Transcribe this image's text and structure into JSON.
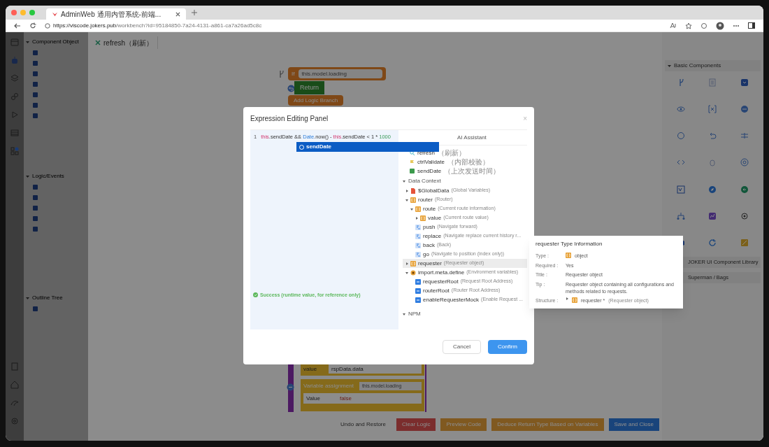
{
  "browser": {
    "tab_title": "AdminWeb 通用内管系统-前端...",
    "url_host": "https://viscode.jokers.pub",
    "url_path": "/workbench?id=95184850-7a24-4131-a861-ca7a26ad5c8c"
  },
  "left_panel": {
    "sections": [
      {
        "title": "Component Object"
      },
      {
        "title": "Logic/Events"
      },
      {
        "title": "Outline Tree"
      }
    ]
  },
  "canvas": {
    "tab": "refresh（刷新）",
    "if_block": {
      "label": "If",
      "field": "this.model.loading"
    },
    "return_block": {
      "label": "Return"
    },
    "branch_block": {
      "label": "Add Logic Branch"
    },
    "value_row": {
      "label": "value",
      "value": "rspData.data"
    },
    "assign_block": {
      "label": "Variable assignment",
      "field": "this.model.loading",
      "row_label": "Value",
      "row_value": "false"
    }
  },
  "bottom_buttons": [
    {
      "label": "Undo and Restore",
      "kind": "plain"
    },
    {
      "label": "Clear Logic",
      "kind": "danger"
    },
    {
      "label": "Preview Code",
      "kind": "warning"
    },
    {
      "label": "Deduce Return Type Based on Variables",
      "kind": "warning"
    },
    {
      "label": "Save and Close",
      "kind": "primary"
    }
  ],
  "right_panel": {
    "section": "Basic Components",
    "libraries": [
      "JOKER UI Component Library",
      "Superman / Bags"
    ]
  },
  "modal": {
    "title": "Expression Editing Panel",
    "close": "×",
    "line_number": "1",
    "code_tokens": [
      {
        "text": "this",
        "kind": "keyword"
      },
      {
        "text": ".sendDate && ",
        "kind": "plain"
      },
      {
        "text": "Date",
        "kind": "class"
      },
      {
        "text": ".now() - ",
        "kind": "plain"
      },
      {
        "text": "this",
        "kind": "keyword"
      },
      {
        "text": ".sendDate < 1 * ",
        "kind": "plain"
      },
      {
        "text": "1000",
        "kind": "number"
      }
    ],
    "suggestion": {
      "label": "sendDate",
      "selected": true
    },
    "tabs": [
      {
        "label": "AI Assistant",
        "selected": false
      }
    ],
    "members": [
      {
        "name": "refresh",
        "desc": "（刷新）",
        "kind": "function"
      },
      {
        "name": "ctrlValidate",
        "desc": "（内部校验）",
        "kind": "handler"
      },
      {
        "name": "sendDate",
        "desc": "（上次发送时间）",
        "kind": "number"
      }
    ],
    "data_context": {
      "title": "Data Context",
      "expanded": true,
      "items": [
        {
          "name": "$GlobalData",
          "desc": "(Global Variables)",
          "kind": "global",
          "expanded": false,
          "selected": false
        },
        {
          "name": "router",
          "desc": "(Router)",
          "kind": "object",
          "expanded": true,
          "selected": false,
          "children": [
            {
              "name": "route",
              "desc": "(Current route information)",
              "kind": "object",
              "expanded": true,
              "selected": false,
              "children": [
                {
                  "name": "value",
                  "desc": "(Current route value)",
                  "kind": "object",
                  "expanded": false,
                  "selected": false
                }
              ]
            },
            {
              "name": "push",
              "desc": "(Navigate forward)",
              "kind": "method",
              "selected": false
            },
            {
              "name": "replace",
              "desc": "(Navigate replace current history r...",
              "kind": "method",
              "selected": false
            },
            {
              "name": "back",
              "desc": "(Back)",
              "kind": "method",
              "selected": false
            },
            {
              "name": "go",
              "desc": "(Navigate to position (index only))",
              "kind": "method",
              "selected": false
            }
          ]
        },
        {
          "name": "requester",
          "desc": "(Requester object)",
          "kind": "object",
          "expanded": false,
          "selected": true
        },
        {
          "name": "import.meta.define",
          "desc": "(Environment variables)",
          "kind": "env",
          "expanded": true,
          "selected": false,
          "children": [
            {
              "name": "requesterRoot",
              "desc": "(Request Root Address)",
              "kind": "string",
              "selected": false
            },
            {
              "name": "routerRoot",
              "desc": "(Router Root Address)",
              "kind": "string",
              "selected": false
            },
            {
              "name": "enableRequesterMock",
              "desc": "(Enable Request ...",
              "kind": "string",
              "selected": false
            }
          ]
        }
      ]
    },
    "npm": {
      "title": "NPM",
      "expanded": true
    },
    "status": "Success (runtime value, for reference only)",
    "buttons": [
      {
        "label": "Cancel",
        "kind": "plain"
      },
      {
        "label": "Confirm",
        "kind": "primary"
      }
    ]
  },
  "tooltip": {
    "title": "requester Type Information",
    "rows": [
      {
        "label": "Type :",
        "value": "object",
        "kind": "type"
      },
      {
        "label": "Required :",
        "value": "Yes",
        "kind": "text"
      },
      {
        "label": "Title :",
        "value": "Requester object",
        "kind": "text"
      },
      {
        "label": "Tip :",
        "value": "Requester object containing all configurations and methods related to requests.",
        "kind": "text"
      },
      {
        "label": "Structure :",
        "value": "requester *",
        "desc": "(Requester object)",
        "kind": "structure"
      }
    ]
  }
}
